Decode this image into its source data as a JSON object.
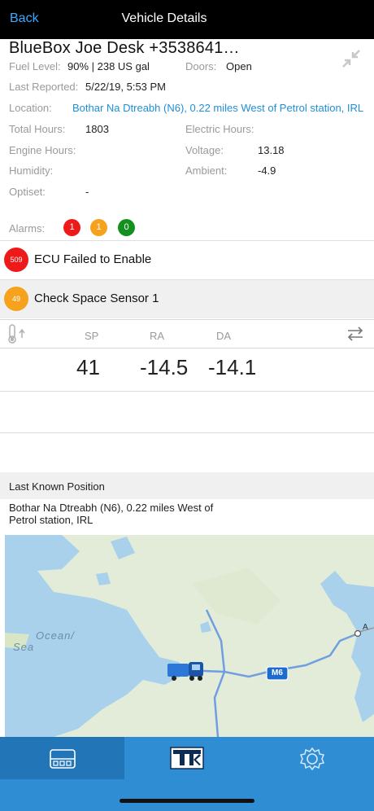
{
  "header": {
    "back_label": "Back",
    "title": "Vehicle Details"
  },
  "vehicle": {
    "name": "BlueBox Joe Desk +3538641…",
    "fuel_label": "Fuel Level:",
    "fuel_value": "90%  | 238 US gal",
    "doors_label": "Doors:",
    "doors_value": "Open",
    "reported_label": "Last Reported:",
    "reported_value": "5/22/19, 5:53 PM",
    "location_label": "Location:",
    "location_value": "Bothar Na Dtreabh (N6), 0.22 miles West of Petrol station, IRL",
    "total_hours_label": "Total Hours:",
    "total_hours_value": "1803",
    "electric_hours_label": "Electric Hours:",
    "engine_hours_label": "Engine Hours:",
    "voltage_label": "Voltage:",
    "voltage_value": "13.18",
    "humidity_label": "Humidity:",
    "ambient_label": "Ambient:",
    "ambient_value": "-4.9",
    "optiset_label": "Optiset:",
    "optiset_value": "-"
  },
  "alarms": {
    "label": "Alarms:",
    "counts": [
      "1",
      "1",
      "0"
    ],
    "colors": [
      "#ee1a1a",
      "#f6a21c",
      "#14901f"
    ],
    "items": [
      {
        "code": "509",
        "text": "ECU Failed to Enable",
        "color": "#ee1a1a"
      },
      {
        "code": "49",
        "text": "Check Space Sensor 1",
        "color": "#f6a21c"
      }
    ]
  },
  "temperature": {
    "headers": [
      "SP",
      "RA",
      "DA"
    ],
    "values": [
      "41",
      "-14.5",
      "-14.1"
    ]
  },
  "position": {
    "title": "Last Known Position",
    "address": "Bothar Na Dtreabh (N6), 0.22 miles West of Petrol station, IRL"
  },
  "map": {
    "water_label_1": "Ocean/",
    "water_label_2": "Sea",
    "road_shield": "M6",
    "edge_label": "A"
  },
  "tabs": [
    {
      "icon": "dashboard-icon",
      "active": true
    },
    {
      "icon": "thermo-king-logo",
      "active": false
    },
    {
      "icon": "gear-icon",
      "active": false
    }
  ],
  "colors": {
    "accent": "#2f8dd4",
    "link": "#1f8fd6",
    "header": "#000000"
  }
}
